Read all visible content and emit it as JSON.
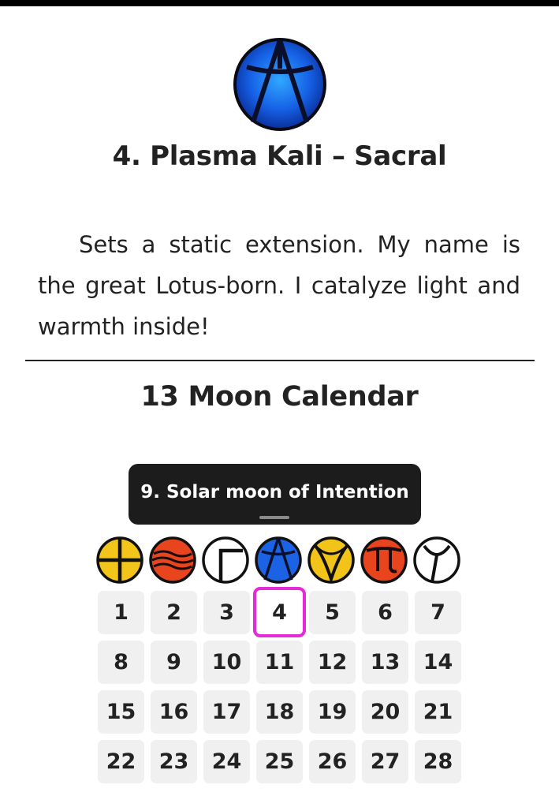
{
  "plasma": {
    "title": "4. Plasma Kali – Sacral",
    "icon": "kali-plasma-icon",
    "description": "Sets a static extension. My name is the great Lotus-born. I catalyze light and warmth inside!"
  },
  "calendar": {
    "title": "13 Moon Calendar",
    "tooltip": "9. Solar moon of Intention",
    "selected_day": 4,
    "plasmas": [
      {
        "name": "dali-plasma-icon",
        "color": "#f3c419"
      },
      {
        "name": "seli-plasma-icon",
        "color": "#e8451e"
      },
      {
        "name": "gamma-plasma-icon",
        "color": "#ffffff"
      },
      {
        "name": "kali-plasma-icon",
        "color": "#1b63e4"
      },
      {
        "name": "alpha-plasma-icon",
        "color": "#f2c319"
      },
      {
        "name": "limi-plasma-icon",
        "color": "#e8451e"
      },
      {
        "name": "silio-plasma-icon",
        "color": "#ffffff"
      }
    ],
    "days": [
      [
        "1",
        "2",
        "3",
        "4",
        "5",
        "6",
        "7"
      ],
      [
        "8",
        "9",
        "10",
        "11",
        "12",
        "13",
        "14"
      ],
      [
        "15",
        "16",
        "17",
        "18",
        "19",
        "20",
        "21"
      ],
      [
        "22",
        "23",
        "24",
        "25",
        "26",
        "27",
        "28"
      ]
    ]
  }
}
